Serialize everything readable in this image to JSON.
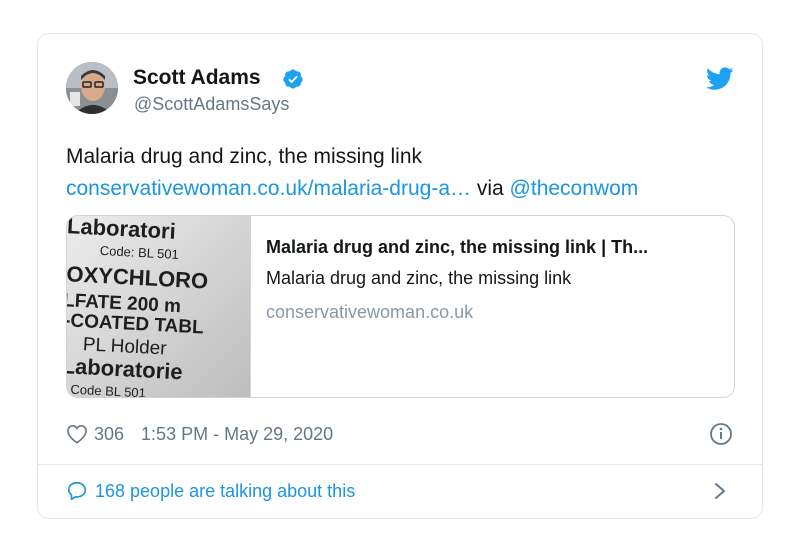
{
  "author": {
    "name": "Scott Adams",
    "handle": "@ScottAdamsSays"
  },
  "tweet": {
    "text": "Malaria drug and zinc, the missing link",
    "link_text": "conservativewoman.co.uk/malaria-drug-a…",
    "via_text": "via",
    "mention": "@theconwom"
  },
  "preview": {
    "title": "Malaria drug and zinc, the missing link | Th...",
    "description": "Malaria drug and zinc, the missing link",
    "domain": "conservativewoman.co.uk",
    "image_lines": [
      "Laboratori",
      "Code: BL 501",
      "OXYCHLORO",
      "LFATE 200 m",
      "-COATED TABL",
      "PL Holder",
      "Laboratorie",
      "Code BL 501"
    ]
  },
  "meta": {
    "likes": "306",
    "timestamp": "1:53 PM - May 29, 2020"
  },
  "footer": {
    "talking": "168 people are talking about this"
  },
  "colors": {
    "link": "#1b95e0",
    "text": "#14171a",
    "secondary": "#657786",
    "border": "#e1e8ed"
  },
  "icons": [
    "verified-badge-icon",
    "twitter-bird-icon",
    "heart-icon",
    "info-icon",
    "speech-bubble-icon",
    "chevron-right-icon"
  ]
}
